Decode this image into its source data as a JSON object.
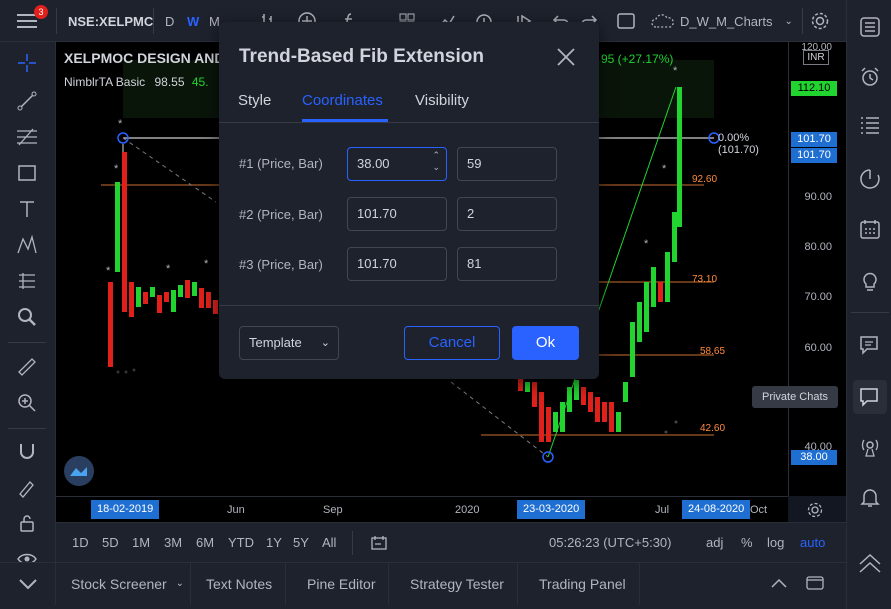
{
  "colors": {
    "accent": "#2962ff",
    "up": "#21d430",
    "down": "#e0211b",
    "fib": "#ff8a3c",
    "badge_blue": "#1e6fd1",
    "badge_green": "#21d430"
  },
  "topbar": {
    "menu_badge": "3",
    "symbol": "NSE:XELPMC",
    "interval_d": "D",
    "interval_w": "W",
    "interval_m": "M",
    "layout_name": "D_W_M_Charts"
  },
  "legend": {
    "title": "XELPMOC DESIGN AND",
    "indicator_name": "NimblrTA Basic",
    "indicator_v1": "98.55",
    "indicator_v2": "45.",
    "change": "95 (+27.17%)"
  },
  "fib_labels": {
    "l1": "0.00%(101.70)",
    "l2": "92.60",
    "l3": "73.10",
    "l4": "58.65",
    "l5": "42.60"
  },
  "price_axis": {
    "labels": [
      "120.00",
      "90.00",
      "80.00",
      "70.00",
      "60.00",
      "40.00"
    ],
    "currency": "INR",
    "badge_112": "112.10",
    "badge_101a": "101.70",
    "badge_101b": "101.70",
    "badge_38": "38.00"
  },
  "time_axis": {
    "badge_start": "18-02-2019",
    "jun": "Jun",
    "sep": "Sep",
    "y2020": "2020",
    "badge_mid": "23-03-2020",
    "jul": "Jul",
    "badge_end": "24-08-2020",
    "oct": "Oct"
  },
  "range_bar": {
    "ranges": [
      "1D",
      "5D",
      "1M",
      "3M",
      "6M",
      "YTD",
      "1Y",
      "5Y",
      "All"
    ],
    "clock": "05:26:23 (UTC+5:30)",
    "adj": "adj",
    "pct": "%",
    "log": "log",
    "auto": "auto"
  },
  "bottom_tabs": [
    "Stock Screener",
    "Text Notes",
    "Pine Editor",
    "Strategy Tester",
    "Trading Panel"
  ],
  "tooltip": "Private Chats",
  "dialog": {
    "title": "Trend-Based Fib Extension",
    "tabs": [
      "Style",
      "Coordinates",
      "Visibility"
    ],
    "rows": [
      {
        "label": "#1 (Price, Bar)",
        "price": "38.00",
        "bar": "59"
      },
      {
        "label": "#2 (Price, Bar)",
        "price": "101.70",
        "bar": "2"
      },
      {
        "label": "#3 (Price, Bar)",
        "price": "101.70",
        "bar": "81"
      }
    ],
    "template_label": "Template",
    "cancel_label": "Cancel",
    "ok_label": "Ok"
  },
  "icons": {
    "menu": "hamburger-icon",
    "crosshair": "crosshair-icon",
    "trendline": "trendline-icon",
    "fib": "fib-icon",
    "rect": "rectangle-icon",
    "text": "text-icon",
    "pattern": "pattern-icon",
    "measure": "measure-icon",
    "zoom": "zoom-icon",
    "ruler": "ruler-icon",
    "magnet": "magnet-icon",
    "lock": "lock-icon",
    "eye": "eye-icon",
    "watchlist": "watchlist-icon",
    "alarm": "alarm-icon",
    "datawindow": "data-window-icon",
    "hotlist": "hotlist-icon",
    "calendar": "calendar-icon",
    "ideas": "ideas-icon",
    "chat": "chat-icon",
    "private_chat": "private-chat-icon",
    "signal": "signal-icon",
    "bell": "bell-icon",
    "settings": "gear-icon"
  }
}
